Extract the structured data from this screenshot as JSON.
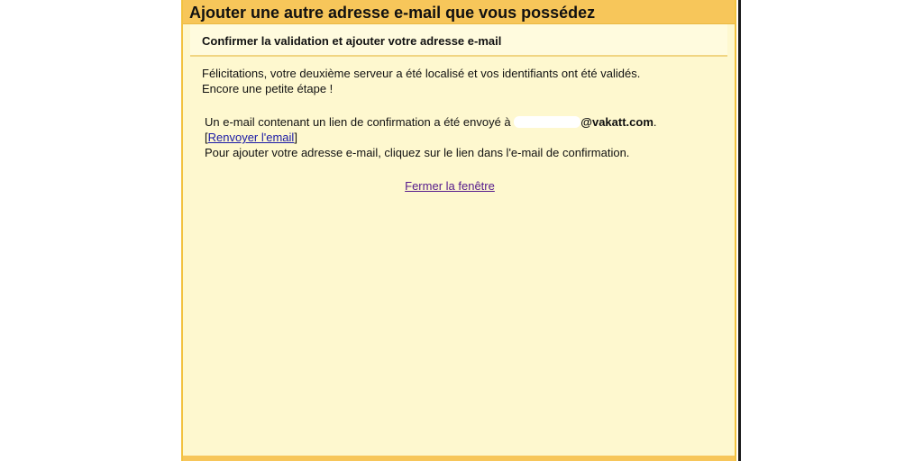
{
  "window": {
    "title": "Ajouter une autre adresse e-mail que vous possédez"
  },
  "section": {
    "header": "Confirmer la validation et ajouter votre adresse e-mail"
  },
  "congrats": {
    "line1": "Félicitations, votre deuxième serveur a été localisé et vos identifiants ont été validés.",
    "line2": "Encore une petite étape !"
  },
  "confirmation": {
    "sent_text": "Un e-mail contenant un lien de confirmation a été envoyé à",
    "email_visible_part": "vakatt.com",
    "email_visible_prefix": "@",
    "bracket_open": "[",
    "resend_link": "Renvoyer l'email",
    "bracket_close": "]",
    "instruction": "Pour ajouter votre adresse e-mail, cliquez sur le lien dans l'e-mail de confirmation."
  },
  "actions": {
    "close_link": "Fermer la fenêtre"
  },
  "colors": {
    "title_bar": "#f7c65a",
    "panel_background": "#fef8cf",
    "link": "#1a1aa6",
    "visited_link": "#551a8b"
  }
}
